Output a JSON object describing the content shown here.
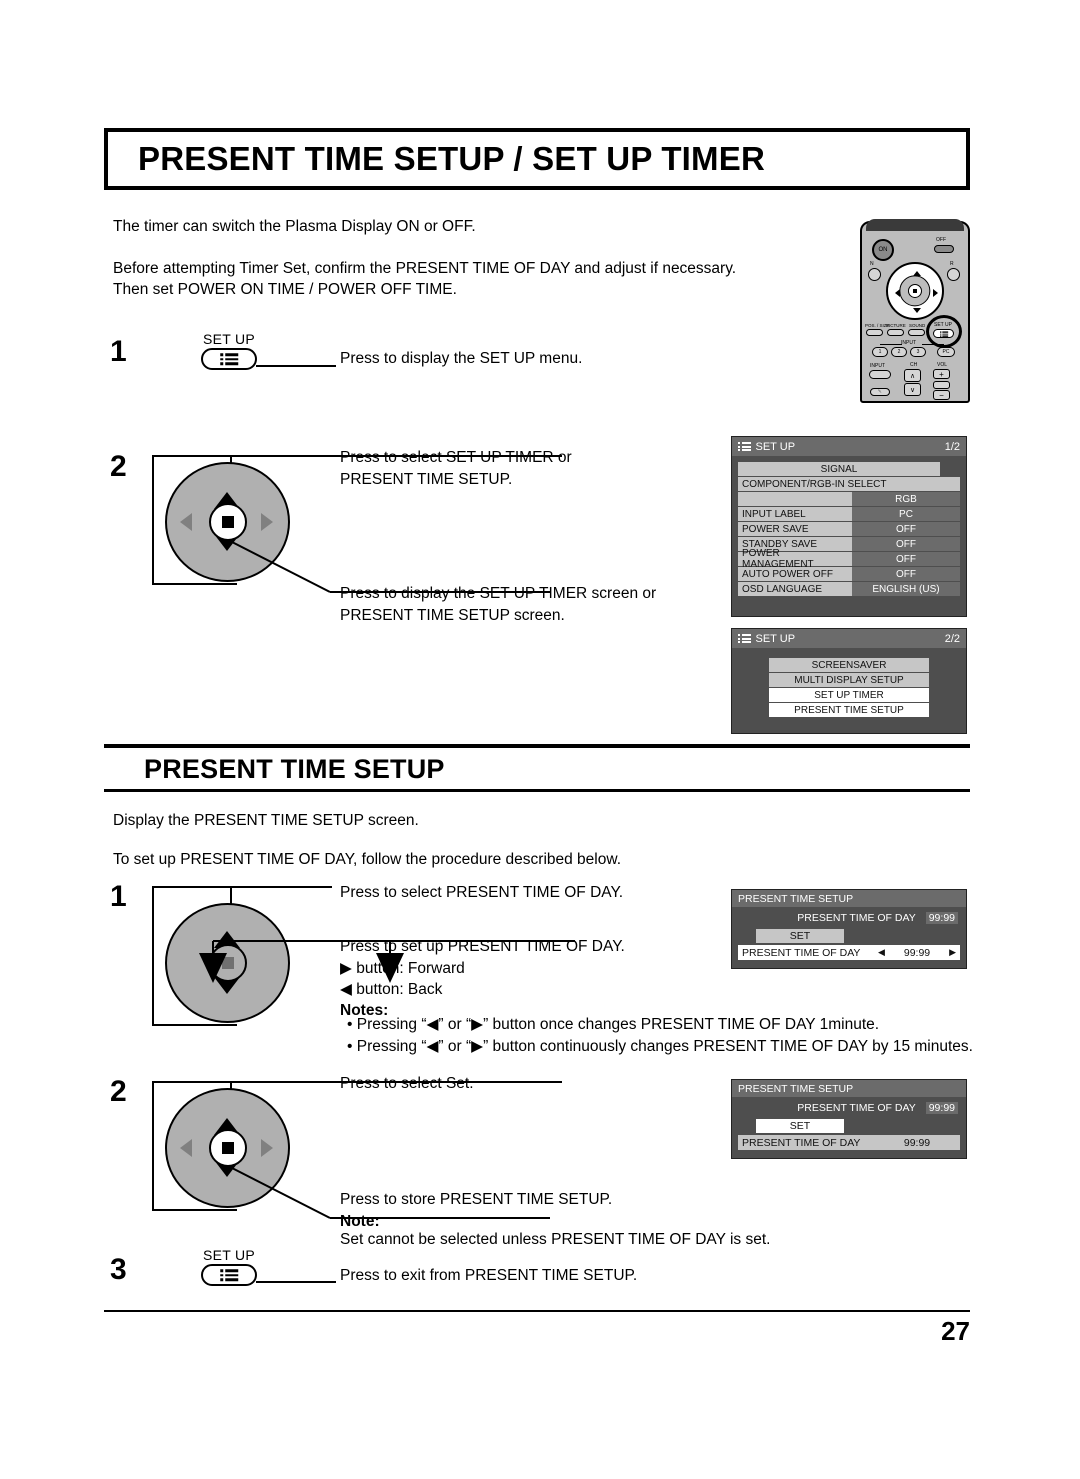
{
  "page": {
    "title": "PRESENT TIME SETUP / SET UP TIMER",
    "page_number": "27",
    "intro_line_1": "The timer can switch the Plasma Display ON or OFF.",
    "intro_line_2": "Before attempting Timer Set, confirm the PRESENT TIME OF DAY and adjust if necessary.",
    "intro_line_3": "Then set POWER ON TIME / POWER OFF TIME."
  },
  "steps_top": [
    {
      "number": "1",
      "key_label": "SET UP",
      "instruction": "Press to display the SET UP menu."
    },
    {
      "number": "2",
      "instruction_a_line1": "Press to select SET UP TIMER or",
      "instruction_a_line2": "PRESENT TIME SETUP.",
      "instruction_b_line1": "Press to display the SET UP TIMER screen or",
      "instruction_b_line2": "PRESENT TIME SETUP screen."
    }
  ],
  "section": {
    "heading": "PRESENT TIME SETUP",
    "line_1": "Display the PRESENT TIME SETUP screen.",
    "line_2": "To set up PRESENT TIME OF DAY, follow the procedure described below."
  },
  "steps_bottom": [
    {
      "number": "1",
      "instruction_a": "Press to select PRESENT TIME OF DAY.",
      "instruction_b": "Press to set up PRESENT TIME OF DAY.",
      "forward_line": "▶ button: Forward",
      "back_line": "◀ button: Back",
      "notes_title": "Notes:",
      "note_1": "• Pressing “◀” or “▶” button once changes PRESENT TIME OF DAY 1minute.",
      "note_2": "• Pressing “◀” or “▶” button continuously changes PRESENT TIME OF DAY by 15 minutes."
    },
    {
      "number": "2",
      "instruction_a": "Press to select Set.",
      "instruction_b": "Press to store PRESENT TIME SETUP.",
      "note_title": "Note:",
      "note_text": "Set cannot be selected unless PRESENT TIME OF DAY is set."
    },
    {
      "number": "3",
      "key_label": "SET UP",
      "instruction": "Press to exit from PRESENT TIME SETUP."
    }
  ],
  "osd_setup_1": {
    "title": "SET UP",
    "page_indicator": "1/2",
    "rows": [
      {
        "label": "SIGNAL",
        "value": "",
        "style": "centered-label-no-value"
      },
      {
        "label": "COMPONENT/RGB-IN SELECT",
        "value": "",
        "style": "wide-label"
      },
      {
        "label": "",
        "value": "RGB",
        "style": "value-only"
      },
      {
        "label": "INPUT LABEL",
        "value": "PC",
        "style": "pair"
      },
      {
        "label": "POWER SAVE",
        "value": "OFF",
        "style": "pair"
      },
      {
        "label": "STANDBY SAVE",
        "value": "OFF",
        "style": "pair"
      },
      {
        "label": "POWER MANAGEMENT",
        "value": "OFF",
        "style": "pair"
      },
      {
        "label": "AUTO POWER OFF",
        "value": "OFF",
        "style": "pair"
      },
      {
        "label": "OSD LANGUAGE",
        "value": "ENGLISH (US)",
        "style": "pair"
      }
    ]
  },
  "osd_setup_2": {
    "title": "SET UP",
    "page_indicator": "2/2",
    "items": [
      {
        "label": "SCREENSAVER",
        "selected": false
      },
      {
        "label": "MULTI DISPLAY SETUP",
        "selected": false
      },
      {
        "label": "SET UP TIMER",
        "selected": true
      },
      {
        "label": "PRESENT TIME SETUP",
        "selected": true
      }
    ]
  },
  "osd_present_time_1": {
    "title": "PRESENT  TIME SETUP",
    "top_label": "PRESENT  TIME OF DAY",
    "top_value": "99:99",
    "set_label": "SET",
    "set_selected": false,
    "field_label": "PRESENT  TIME OF DAY",
    "field_value": "99:99",
    "field_selected": true,
    "arrow_left": "◀",
    "arrow_right": "▶"
  },
  "osd_present_time_2": {
    "title": "PRESENT  TIME SETUP",
    "top_label": "PRESENT  TIME OF DAY",
    "top_value": "99:99",
    "set_label": "SET",
    "set_selected": true,
    "field_label": "PRESENT  TIME OF DAY",
    "field_value": "99:99",
    "field_selected": false
  },
  "remote": {
    "on_label": "ON",
    "off_label": "OFF",
    "n_label": "N",
    "r_label": "R",
    "pos_size_label": "POS. / SIZE",
    "picture_label": "PICTURE",
    "sound_label": "SOUND",
    "set_up_label": "SET UP",
    "input_group_label": "INPUT",
    "input_1": "1",
    "input_2": "2",
    "input_3": "3",
    "input_pc": "PC",
    "input_btn_label": "INPUT",
    "ch_label": "CH",
    "vol_label": "VOL",
    "ch_up": "∧",
    "ch_down": "∨",
    "vol_plus": "+",
    "vol_minus": "−",
    "mute_label": "␡"
  },
  "colors": {
    "osd_background": "#4e4e4e",
    "osd_titlebar": "#6b6b6b",
    "osd_label": "#c6c6c6",
    "osd_selected": "#ffffff",
    "wheel_fill": "#b0b0b0",
    "remote_body": "#bdbdbd",
    "text": "#000000"
  }
}
